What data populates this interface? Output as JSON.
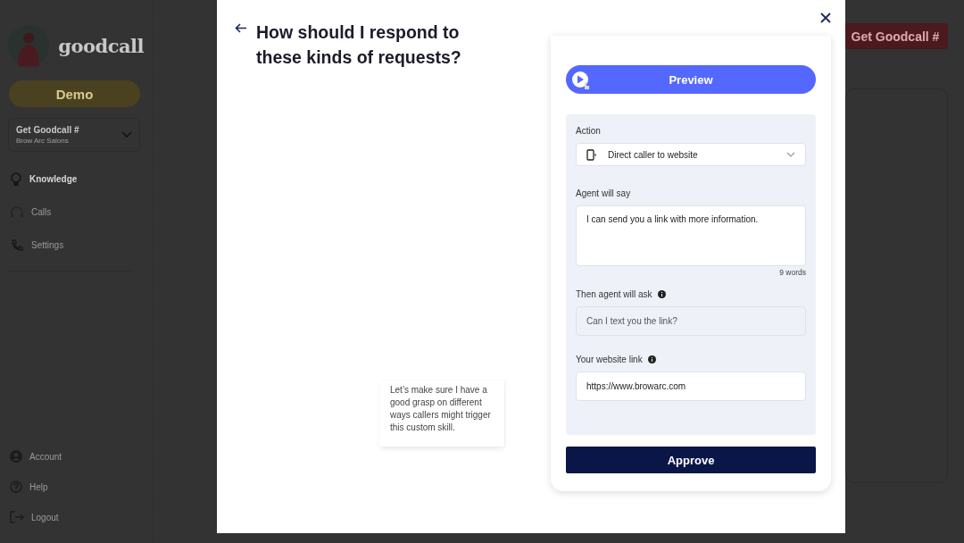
{
  "sidebar": {
    "logo": "goodcall",
    "demo_button": "Demo",
    "number_select": {
      "label": "Get Goodcall #",
      "sublabel": "Brow Arc Salons"
    },
    "nav": [
      {
        "label": "Knowledge",
        "selected": true
      },
      {
        "label": "Calls",
        "selected": false
      },
      {
        "label": "Settings",
        "selected": false
      }
    ],
    "footer": [
      {
        "label": "Account"
      },
      {
        "label": "Help"
      },
      {
        "label": "Logout"
      }
    ]
  },
  "header": {
    "cta_button": "Get Goodcall #"
  },
  "modal": {
    "title": "How should I respond to these kinds of requests?",
    "bubble": "Let’s make sure I have a good grasp on different ways callers might trigger this custom skill.",
    "preview_button": "Preview",
    "form": {
      "action": {
        "label": "Action",
        "value": "Direct caller to website"
      },
      "agent_says": {
        "label": "Agent will say",
        "value": "I can send you a link with more information.",
        "count": "9 words"
      },
      "agent_asks": {
        "label": "Then agent will ask",
        "placeholder": "Can I text you the link?"
      },
      "website": {
        "label": "Your website link",
        "value": "https://www.browarc.com"
      }
    },
    "approve_button": "Approve"
  }
}
